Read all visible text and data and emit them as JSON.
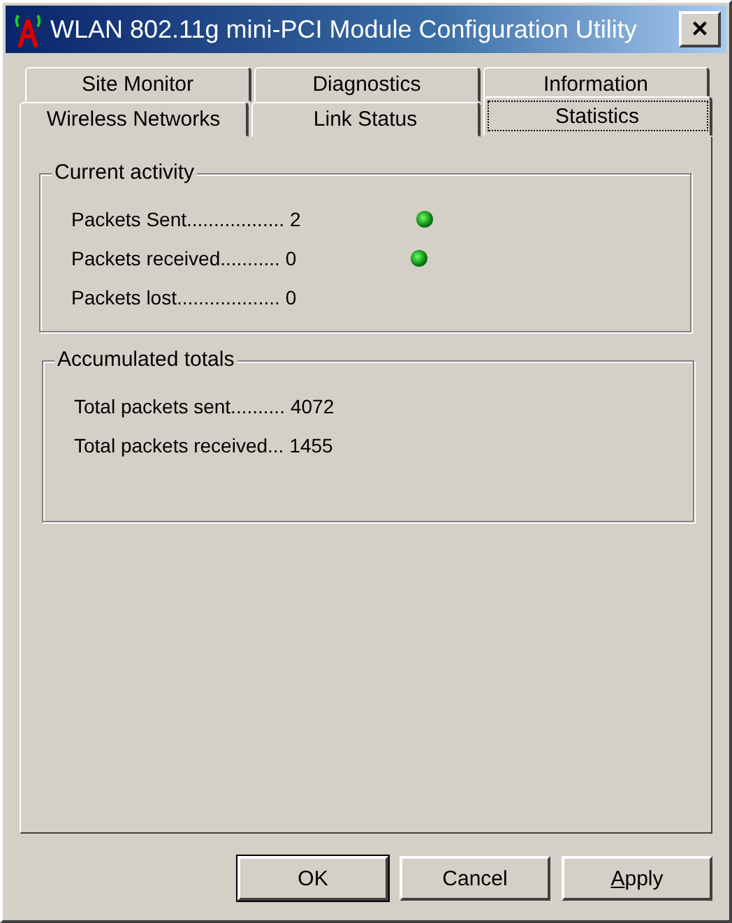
{
  "window": {
    "title": "WLAN 802.11g mini-PCI Module Configuration Utility",
    "close": "×"
  },
  "tab_rows": [
    [
      {
        "label": "Site Monitor",
        "selected": false
      },
      {
        "label": "Diagnostics",
        "selected": false
      },
      {
        "label": "Information",
        "selected": false
      }
    ],
    [
      {
        "label": "Wireless Networks",
        "selected": false
      },
      {
        "label": "Link Status",
        "selected": false
      },
      {
        "label": "Statistics",
        "selected": true
      }
    ]
  ],
  "groups": [
    {
      "title": "Current activity",
      "rows": [
        {
          "label": "Packets Sent..................",
          "value": "2",
          "indicator": true
        },
        {
          "label": "Packets received...........",
          "value": "0",
          "indicator": true
        },
        {
          "label": "Packets lost...................",
          "value": "0",
          "indicator": false
        }
      ]
    },
    {
      "title": "Accumulated totals",
      "rows": [
        {
          "label": "Total packets sent..........",
          "value": "4072"
        },
        {
          "label": "Total packets received...",
          "value": "1455"
        }
      ]
    }
  ],
  "buttons": [
    {
      "label": "OK",
      "default": true,
      "underline_first": false
    },
    {
      "label": "Cancel",
      "default": false,
      "underline_first": false
    },
    {
      "label": "Apply",
      "default": false,
      "underline_first": true
    }
  ]
}
